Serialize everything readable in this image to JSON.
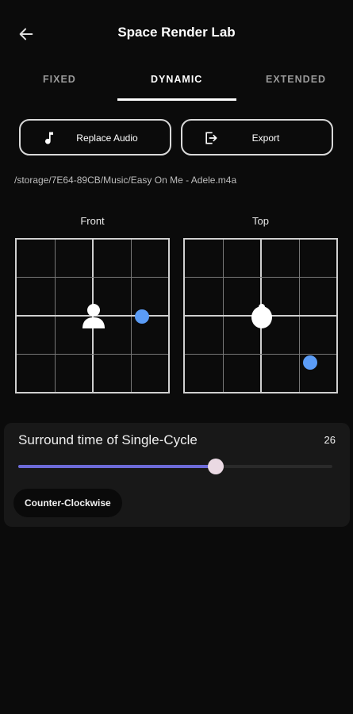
{
  "app_bar": {
    "title": "Space Render Lab",
    "back_icon": "arrow-left-icon"
  },
  "tabs": [
    {
      "label": "FIXED",
      "active": false
    },
    {
      "label": "DYNAMIC",
      "active": true
    },
    {
      "label": "EXTENDED",
      "active": false
    }
  ],
  "actions": {
    "replace_label": "Replace Audio",
    "replace_icon": "music-note-icon",
    "export_label": "Export",
    "export_icon": "export-icon"
  },
  "audio_path": "/storage/7E64-89CB/Music/Easy On Me - Adele.m4a",
  "panels": {
    "front_label": "Front",
    "top_label": "Top",
    "source_color": "#5b9cf6"
  },
  "cycle": {
    "title": "Surround time of Single-Cycle",
    "value": "26",
    "slider_fraction": 0.63,
    "direction_label": "Counter-Clockwise",
    "accent": "#6d6bd8"
  }
}
